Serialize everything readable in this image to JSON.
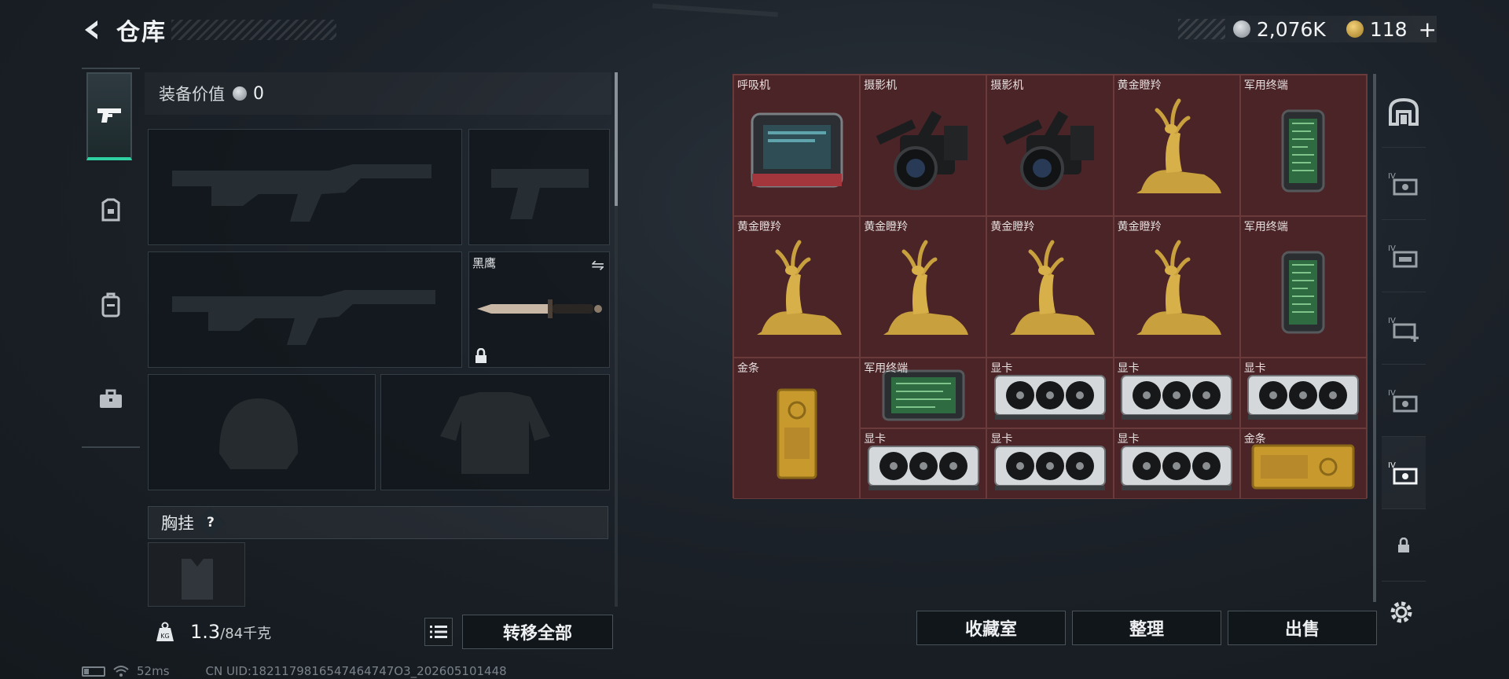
{
  "header": {
    "title": "仓库"
  },
  "currency": {
    "silver": "2,076K",
    "gold": "118",
    "plus": "+"
  },
  "equipment": {
    "value_label": "装备价值",
    "value": "0",
    "melee_name": "黑鹰",
    "chest_label": "胸挂",
    "help": "?",
    "weight": "1.3",
    "capacity": "/84千克",
    "transfer_all": "转移全部"
  },
  "storage": {
    "rows": [
      [
        "呼吸机",
        "摄影机",
        "摄影机",
        "黄金瞪羚",
        "军用终端"
      ],
      [
        "黄金瞪羚",
        "黄金瞪羚",
        "黄金瞪羚",
        "黄金瞪羚",
        "军用终端"
      ],
      [
        "军用终端",
        "显卡",
        "显卡",
        "显卡",
        "金条"
      ],
      [
        "显卡",
        "显卡",
        "显卡",
        "金条",
        ""
      ]
    ],
    "buttons": {
      "collection": "收藏室",
      "sort": "整理",
      "sell": "出售"
    }
  },
  "status": {
    "ping": "52ms",
    "uid": "CN UID:1821179816547464747O3_202605101448"
  },
  "colors": {
    "accent": "#2fd0a2",
    "grid_bg": "#4a2427",
    "grid_border": "#6b3b3c"
  }
}
